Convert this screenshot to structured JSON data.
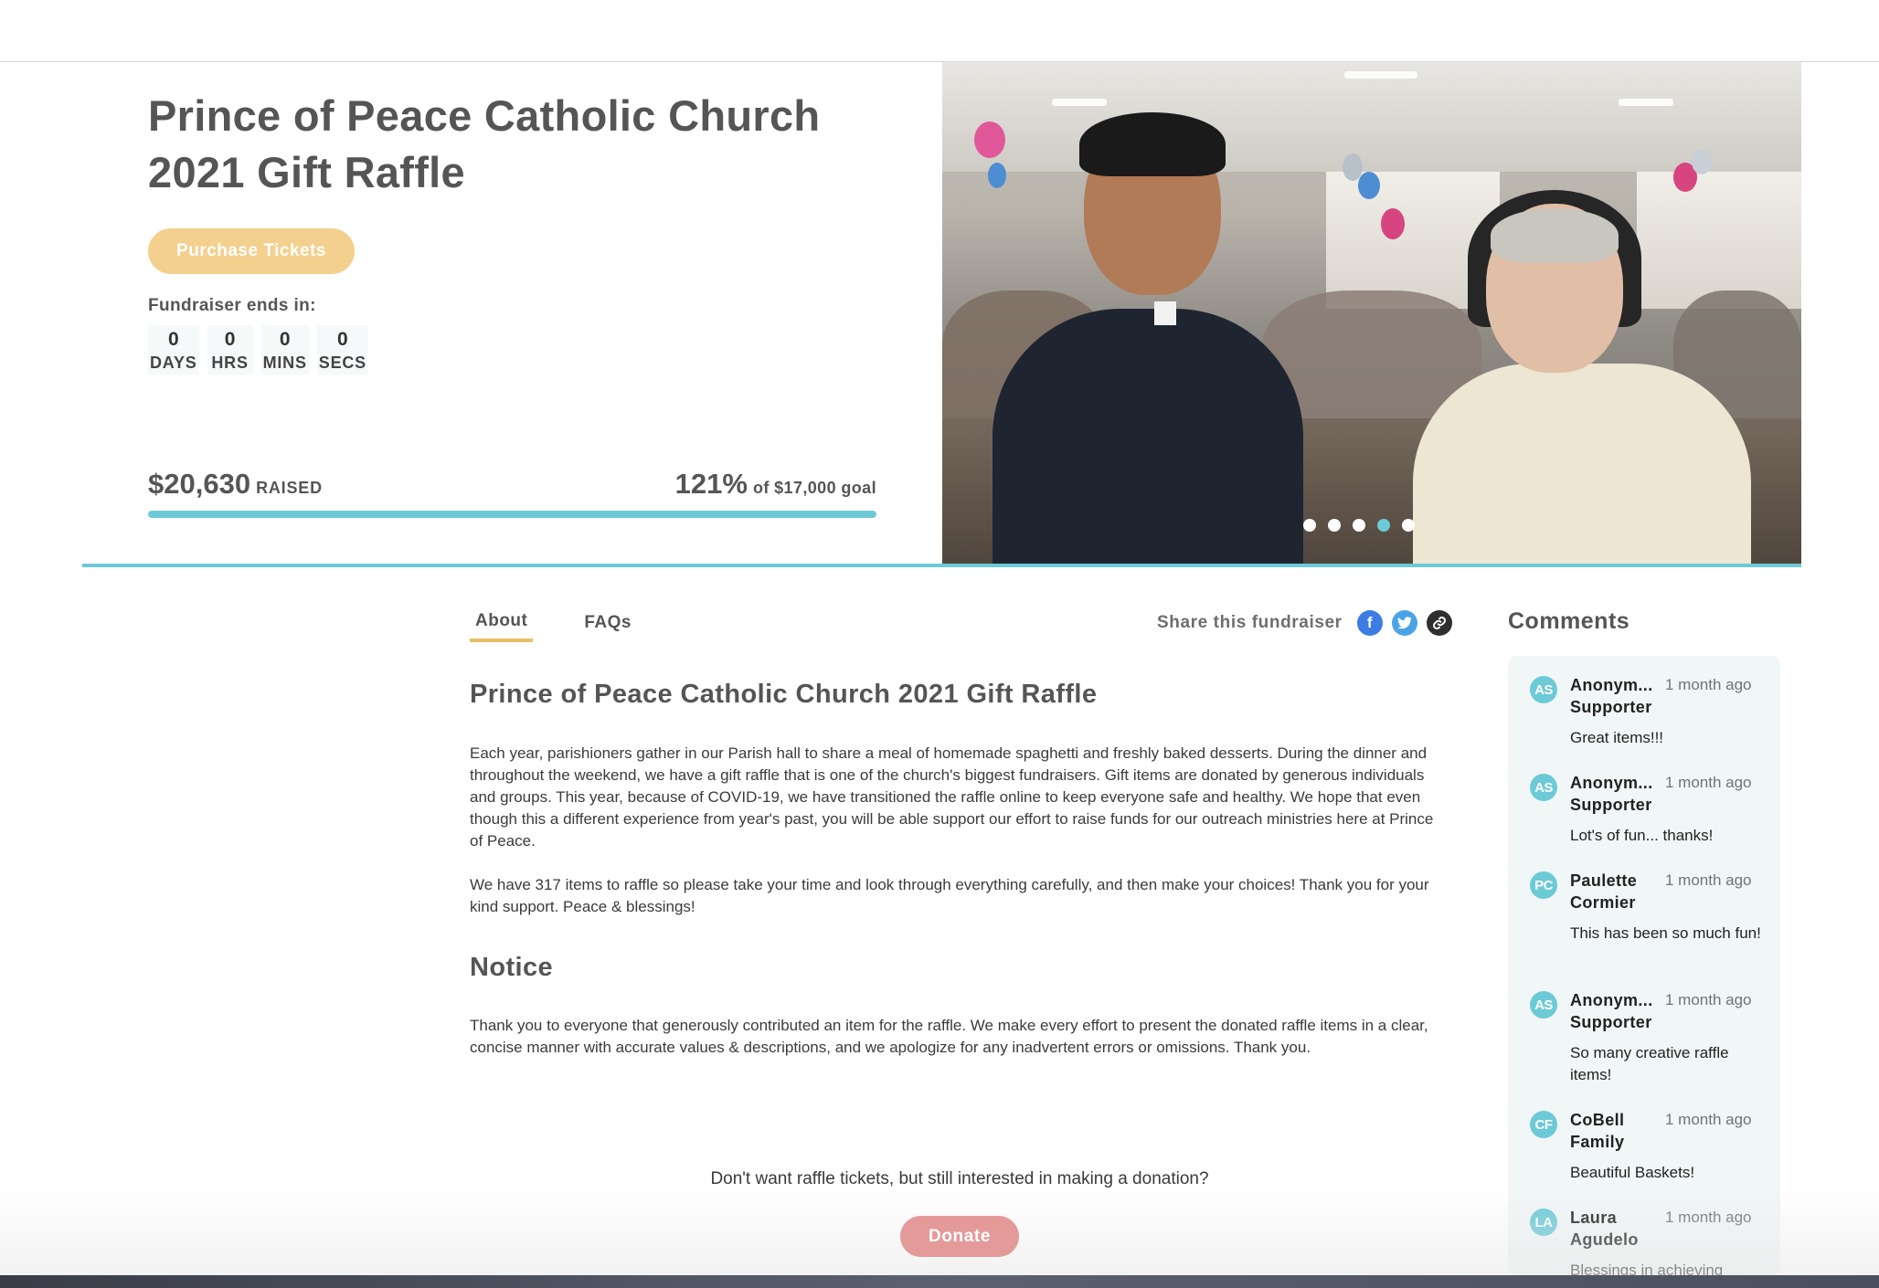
{
  "hero": {
    "title_line1": "Prince of Peace Catholic Church",
    "title_line2": "2021 Gift Raffle",
    "purchase_label": "Purchase Tickets",
    "ends_label": "Fundraiser ends in:",
    "countdown": [
      {
        "value": "0",
        "unit": "DAYS"
      },
      {
        "value": "0",
        "unit": "HRS"
      },
      {
        "value": "0",
        "unit": "MINS"
      },
      {
        "value": "0",
        "unit": "SECS"
      }
    ],
    "raised_amount": "$20,630",
    "raised_label": "RAISED",
    "goal_percent": "121%",
    "goal_label": "of $17,000 goal",
    "progress_fraction": 1.0,
    "carousel_dots": 5,
    "carousel_active_index": 3
  },
  "tabs": [
    {
      "label": "About",
      "active": true
    },
    {
      "label": "FAQs",
      "active": false
    }
  ],
  "share": {
    "label": "Share this fundraiser",
    "icons": [
      "facebook-icon",
      "twitter-icon",
      "link-icon"
    ]
  },
  "about": {
    "heading": "Prince of Peace Catholic Church 2021 Gift Raffle",
    "paragraph1": "Each year, parishioners gather in our Parish hall to share a meal of homemade spaghetti and freshly baked desserts. During the dinner and throughout the weekend, we have a gift raffle that is one of the church's biggest fundraisers. Gift items are donated by generous individuals and groups. This year, because of COVID-19, we have transitioned the raffle online to keep everyone safe and healthy. We hope that even though this a different experience from year's past, you will be able support our effort to raise funds for our outreach ministries here at Prince of Peace.",
    "paragraph2": "We have 317 items to raffle so please take your time and look through everything carefully, and then make your choices! Thank you for your kind support. Peace & blessings!",
    "notice_heading": "Notice",
    "notice_text": "Thank you to everyone that generously contributed an item for the raffle. We make every effort to present the donated raffle items in a clear, concise manner with accurate values & descriptions, and we apologize for any inadvertent errors or omissions. Thank you."
  },
  "donate": {
    "prompt": "Don't want raffle tickets, but still interested in making a donation?",
    "button_label": "Donate"
  },
  "comments": {
    "title": "Comments",
    "items": [
      {
        "initials": "AS",
        "name": "Anonym... Supporter",
        "time": "1 month ago",
        "text": "Great items!!!"
      },
      {
        "initials": "AS",
        "name": "Anonym... Supporter",
        "time": "1 month ago",
        "text": "Lot's of fun... thanks!"
      },
      {
        "initials": "PC",
        "name": "Paulette Cormier",
        "time": "1 month ago",
        "text": "This has been so much fun!"
      },
      {
        "initials": "AS",
        "name": "Anonym... Supporter",
        "time": "1 month ago",
        "text": "So many creative raffle items!"
      },
      {
        "initials": "CF",
        "name": "CoBell Family",
        "time": "1 month ago",
        "text": "Beautiful Baskets!"
      },
      {
        "initials": "LA",
        "name": "Laura Agudelo",
        "time": "1 month ago",
        "text": "Blessings in achieving"
      }
    ]
  },
  "colors": {
    "accent_teal": "#6ccad7",
    "purchase_button": "#f3d08e",
    "donate_button": "#e59a9a",
    "tab_underline": "#e8bf68"
  }
}
